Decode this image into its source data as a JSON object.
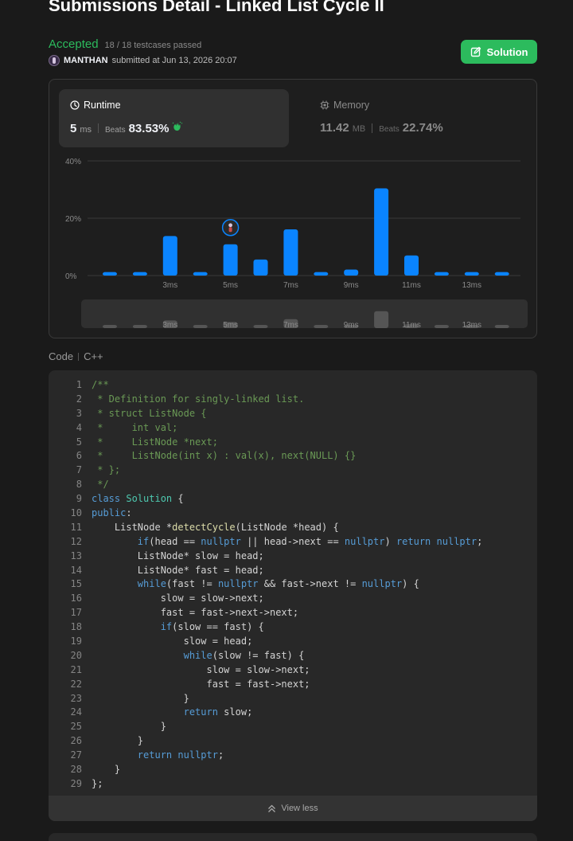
{
  "page": {
    "title": "Submissions Detail - Linked List Cycle II"
  },
  "submission": {
    "status": "Accepted",
    "testcases": "18 / 18 testcases passed",
    "user": "MANTHAN",
    "submitted_text": "submitted at Jun 13, 2026 20:07",
    "solution_button": "Solution"
  },
  "runtime": {
    "label": "Runtime",
    "value": "5",
    "unit": "ms",
    "beats_label": "Beats",
    "beats": "83.53%"
  },
  "memory": {
    "label": "Memory",
    "value": "11.42",
    "unit": "MB",
    "beats_label": "Beats",
    "beats": "22.74%"
  },
  "chart_data": {
    "type": "bar",
    "y_ticks": [
      "40%",
      "20%",
      "0%"
    ],
    "ylim": [
      0,
      40
    ],
    "x_tick_labels": [
      "3ms",
      "5ms",
      "7ms",
      "9ms",
      "11ms",
      "13ms"
    ],
    "values": [
      1.2,
      1.2,
      13.8,
      1.2,
      10.9,
      5.6,
      16.1,
      1.2,
      2.1,
      30.4,
      7.0,
      1.2,
      1.2,
      1.2
    ],
    "highlight_index": 4,
    "bar_color": "#0a84ff",
    "overview_color": "#5a5a5a",
    "overview_highlight_index": 9
  },
  "code": {
    "label": "Code",
    "language": "C++",
    "lines": [
      [
        [
          "cm",
          "/**"
        ]
      ],
      [
        [
          "cm",
          " * Definition for singly-linked list."
        ]
      ],
      [
        [
          "cm",
          " * struct ListNode {"
        ]
      ],
      [
        [
          "cm",
          " *     int val;"
        ]
      ],
      [
        [
          "cm",
          " *     ListNode *next;"
        ]
      ],
      [
        [
          "cm",
          " *     ListNode(int x) : val(x), next(NULL) {}"
        ]
      ],
      [
        [
          "cm",
          " * };"
        ]
      ],
      [
        [
          "cm",
          " */"
        ]
      ],
      [
        [
          "kw",
          "class "
        ],
        [
          "ty",
          "Solution"
        ],
        [
          "tx",
          " {"
        ]
      ],
      [
        [
          "kw",
          "public"
        ],
        [
          "tx",
          ":"
        ]
      ],
      [
        [
          "tx",
          "    ListNode *"
        ],
        [
          "fn",
          "detectCycle"
        ],
        [
          "tx",
          "(ListNode *head) {"
        ]
      ],
      [
        [
          "tx",
          "        "
        ],
        [
          "kw",
          "if"
        ],
        [
          "tx",
          "(head == "
        ],
        [
          "kw",
          "nullptr"
        ],
        [
          "tx",
          " || head->next == "
        ],
        [
          "kw",
          "nullptr"
        ],
        [
          "tx",
          ") "
        ],
        [
          "kw",
          "return"
        ],
        [
          "tx",
          " "
        ],
        [
          "kw",
          "nullptr"
        ],
        [
          "tx",
          ";"
        ]
      ],
      [
        [
          "tx",
          "        ListNode* slow = head;"
        ]
      ],
      [
        [
          "tx",
          "        ListNode* fast = head;"
        ]
      ],
      [
        [
          "tx",
          "        "
        ],
        [
          "kw",
          "while"
        ],
        [
          "tx",
          "(fast != "
        ],
        [
          "kw",
          "nullptr"
        ],
        [
          "tx",
          " && fast->next != "
        ],
        [
          "kw",
          "nullptr"
        ],
        [
          "tx",
          ") {"
        ]
      ],
      [
        [
          "tx",
          "            slow = slow->next;"
        ]
      ],
      [
        [
          "tx",
          "            fast = fast->next->next;"
        ]
      ],
      [
        [
          "tx",
          "            "
        ],
        [
          "kw",
          "if"
        ],
        [
          "tx",
          "(slow == fast) {"
        ]
      ],
      [
        [
          "tx",
          "                slow = head;"
        ]
      ],
      [
        [
          "tx",
          "                "
        ],
        [
          "kw",
          "while"
        ],
        [
          "tx",
          "(slow != fast) {"
        ]
      ],
      [
        [
          "tx",
          "                    slow = slow->next;"
        ]
      ],
      [
        [
          "tx",
          "                    fast = fast->next;"
        ]
      ],
      [
        [
          "tx",
          "                }"
        ]
      ],
      [
        [
          "tx",
          "                "
        ],
        [
          "kw",
          "return"
        ],
        [
          "tx",
          " slow;"
        ]
      ],
      [
        [
          "tx",
          "            }"
        ]
      ],
      [
        [
          "tx",
          "        }"
        ]
      ],
      [
        [
          "tx",
          "        "
        ],
        [
          "kw",
          "return"
        ],
        [
          "tx",
          " "
        ],
        [
          "kw",
          "nullptr"
        ],
        [
          "tx",
          ";"
        ]
      ],
      [
        [
          "tx",
          "    }"
        ]
      ],
      [
        [
          "tx",
          "};"
        ]
      ]
    ]
  },
  "view_less": "View less",
  "icons": {
    "runtime": "clock-icon",
    "memory": "chip-icon",
    "beats_badge": "clapping-hands-icon",
    "solution": "edit-icon",
    "view_less": "double-chevron-up-icon"
  }
}
